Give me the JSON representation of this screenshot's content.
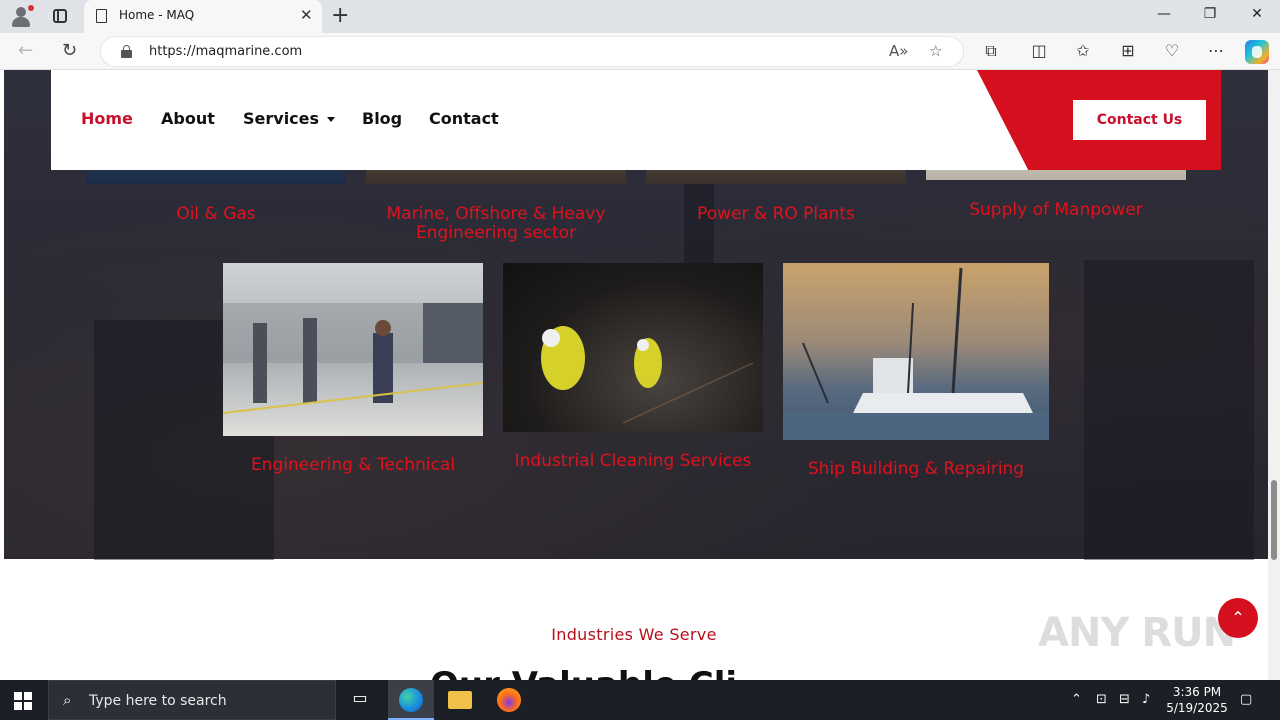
{
  "browser": {
    "tab_title": "Home - MAQ",
    "url": "https://maqmarine.com"
  },
  "site": {
    "nav": {
      "home": "Home",
      "about": "About",
      "services": "Services",
      "blog": "Blog",
      "contact": "Contact",
      "cta": "Contact Us"
    },
    "services_row1": [
      "Oil & Gas",
      "Marine, Offshore & Heavy Engineering sector",
      "Power & RO Plants",
      "Supply of Manpower"
    ],
    "services_row2": [
      "Engineering & Technical",
      "Industrial Cleaning Services",
      "Ship Building & Repairing"
    ],
    "industries_label": "Industries We Serve",
    "heading_partial": "Our Valuable Cli...",
    "watermark": "ANY RUN"
  },
  "taskbar": {
    "search_placeholder": "Type here to search",
    "time": "3:36 PM",
    "date": "5/19/2025"
  },
  "icons": [
    "profile-icon",
    "tabs-icon",
    "document-icon",
    "close-icon",
    "new-tab-icon",
    "minimize-icon",
    "maximize-icon",
    "window-close-icon",
    "back-icon",
    "refresh-icon",
    "lock-icon",
    "read-aloud-icon",
    "favorite-icon",
    "extensions-icon",
    "split-screen-icon",
    "favorites-icon",
    "collections-icon",
    "browser-essentials-icon",
    "more-icon",
    "copilot-icon",
    "caret-down-icon",
    "arrow-up-icon",
    "windows-start-icon",
    "search-icon",
    "task-view-icon",
    "edge-icon",
    "file-explorer-icon",
    "firefox-icon"
  ],
  "colors": {
    "brand_red": "#d40f1e",
    "link_red": "#e0121c",
    "active_nav": "#c8102e"
  }
}
